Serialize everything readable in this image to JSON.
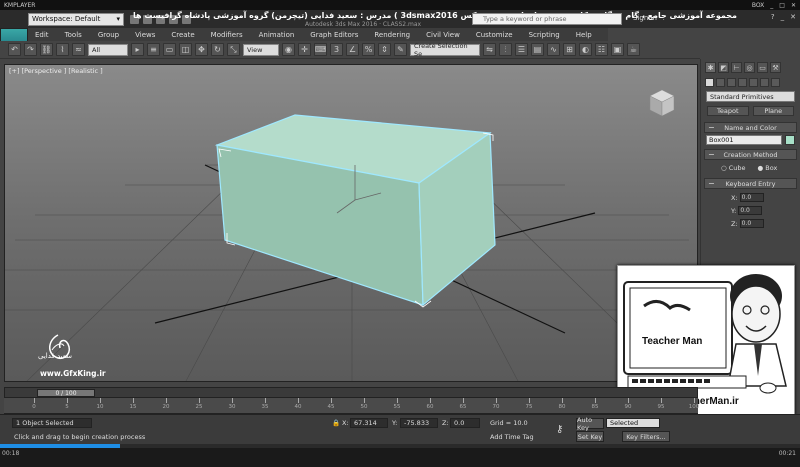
{
  "player": {
    "name": "KMPLAYER",
    "right_label": "BOX",
    "time_current": "00:18",
    "time_end": "00:21",
    "progress_pct": 15
  },
  "titlebar": {
    "workspace_label": "Workspace: Default",
    "course_title": "مجموعه آموزشی جامع ، گام به گام و کاربردی نرم افزار تری دی مکس 3dsmax2016 )   مدرس : سعید فدایی (تیچرمن) گروه آموزشی پادشاه گرافیست ها",
    "subtitle": "Autodesk 3ds Max 2016 · CLASS2.max",
    "search_placeholder": "Type a keyword or phrase",
    "sign_in": "Sign In"
  },
  "menu": {
    "items": [
      "Edit",
      "Tools",
      "Group",
      "Views",
      "Create",
      "Modifiers",
      "Animation",
      "Graph Editors",
      "Rendering",
      "Civil View",
      "Customize",
      "Scripting",
      "Help"
    ]
  },
  "max_logo": "MAX",
  "toolbar": {
    "filter_select": "All",
    "view_select": "View",
    "selection_set": "Create Selection Se"
  },
  "viewport": {
    "label": "[+] [Perspective ] [Realistic ]"
  },
  "command_panel": {
    "category_select": "Standard Primitives",
    "object_buttons": [
      "Teapot",
      "Plane"
    ],
    "rollouts": {
      "name_color": "Name and Color",
      "creation_method": "Creation Method",
      "keyboard_entry": "Keyboard Entry"
    },
    "object_name": "Box001",
    "swatch_color": "#a8e0c8",
    "radio_options": [
      "Cube",
      "Box"
    ],
    "selected_radio": "Box",
    "coords": [
      {
        "axis": "X:",
        "value": "0.0"
      },
      {
        "axis": "Y:",
        "value": "0.0"
      },
      {
        "axis": "Z:",
        "value": "0.0"
      }
    ]
  },
  "timeline": {
    "slider_label": "0 / 100",
    "ticks": [
      0,
      5,
      10,
      15,
      20,
      25,
      30,
      35,
      40,
      45,
      50,
      55,
      60,
      65,
      70,
      75,
      80,
      85,
      90,
      95,
      100
    ]
  },
  "status": {
    "selection_info": "1 Object Selected",
    "prompt": "Click and drag to begin creation process",
    "x_label": "X:",
    "x_value": "67.314",
    "y_label": "Y:",
    "y_value": "-75.833",
    "z_label": "Z:",
    "z_value": "0.0",
    "grid": "Grid = 10.0",
    "add_time_tag": "Add Time Tag",
    "auto_key": "Auto Key",
    "set_key": "Set Key",
    "selected_option": "Selected",
    "key_filters": "Key Filters..."
  },
  "watermark": {
    "author_name": "سعید فدایی",
    "site_url": "www.GfxKing.ir",
    "teacher_card_title": "Teacher Man",
    "teacher_card_url": "www.TeacherMan.ir"
  },
  "colors": {
    "box_face": "#a8d4c4",
    "box_edge": "#9fe8ff",
    "accent": "#1e8ee6"
  }
}
